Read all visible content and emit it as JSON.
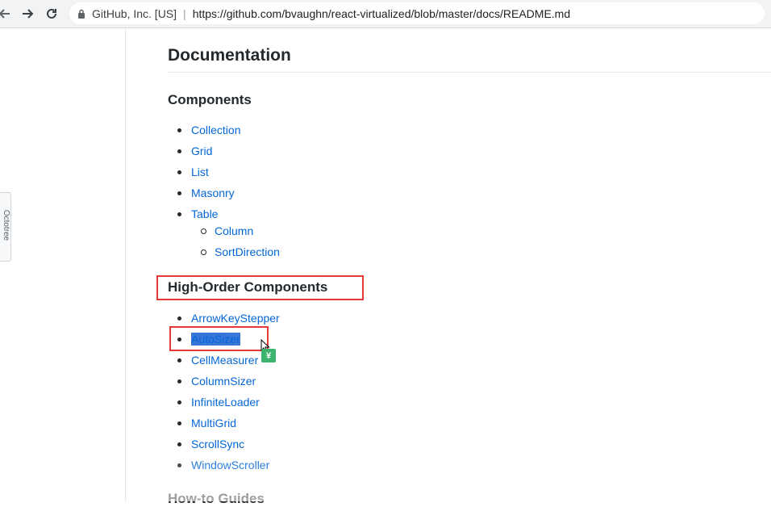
{
  "browser": {
    "site_name": "GitHub, Inc. [US]",
    "url": "https://github.com/bvaughn/react-virtualized/blob/master/docs/README.md"
  },
  "side_tab": {
    "label": "Octotree"
  },
  "doc": {
    "title": "Documentation",
    "components": {
      "heading": "Components",
      "items": [
        "Collection",
        "Grid",
        "List",
        "Masonry",
        "Table"
      ],
      "table_children": [
        "Column",
        "SortDirection"
      ]
    },
    "hoc": {
      "heading": "High-Order Components",
      "items": [
        "ArrowKeyStepper",
        "AutoSizer",
        "CellMeasurer",
        "ColumnSizer",
        "InfiniteLoader",
        "MultiGrid",
        "ScrollSync",
        "WindowScroller"
      ],
      "selected": "AutoSizer"
    },
    "next_heading": "How-to Guides"
  },
  "colors": {
    "link": "#0366d6",
    "highlight": "#e53935",
    "selection": "#3a76d8",
    "badge": "#3cb46e"
  },
  "badge_text": "¥"
}
